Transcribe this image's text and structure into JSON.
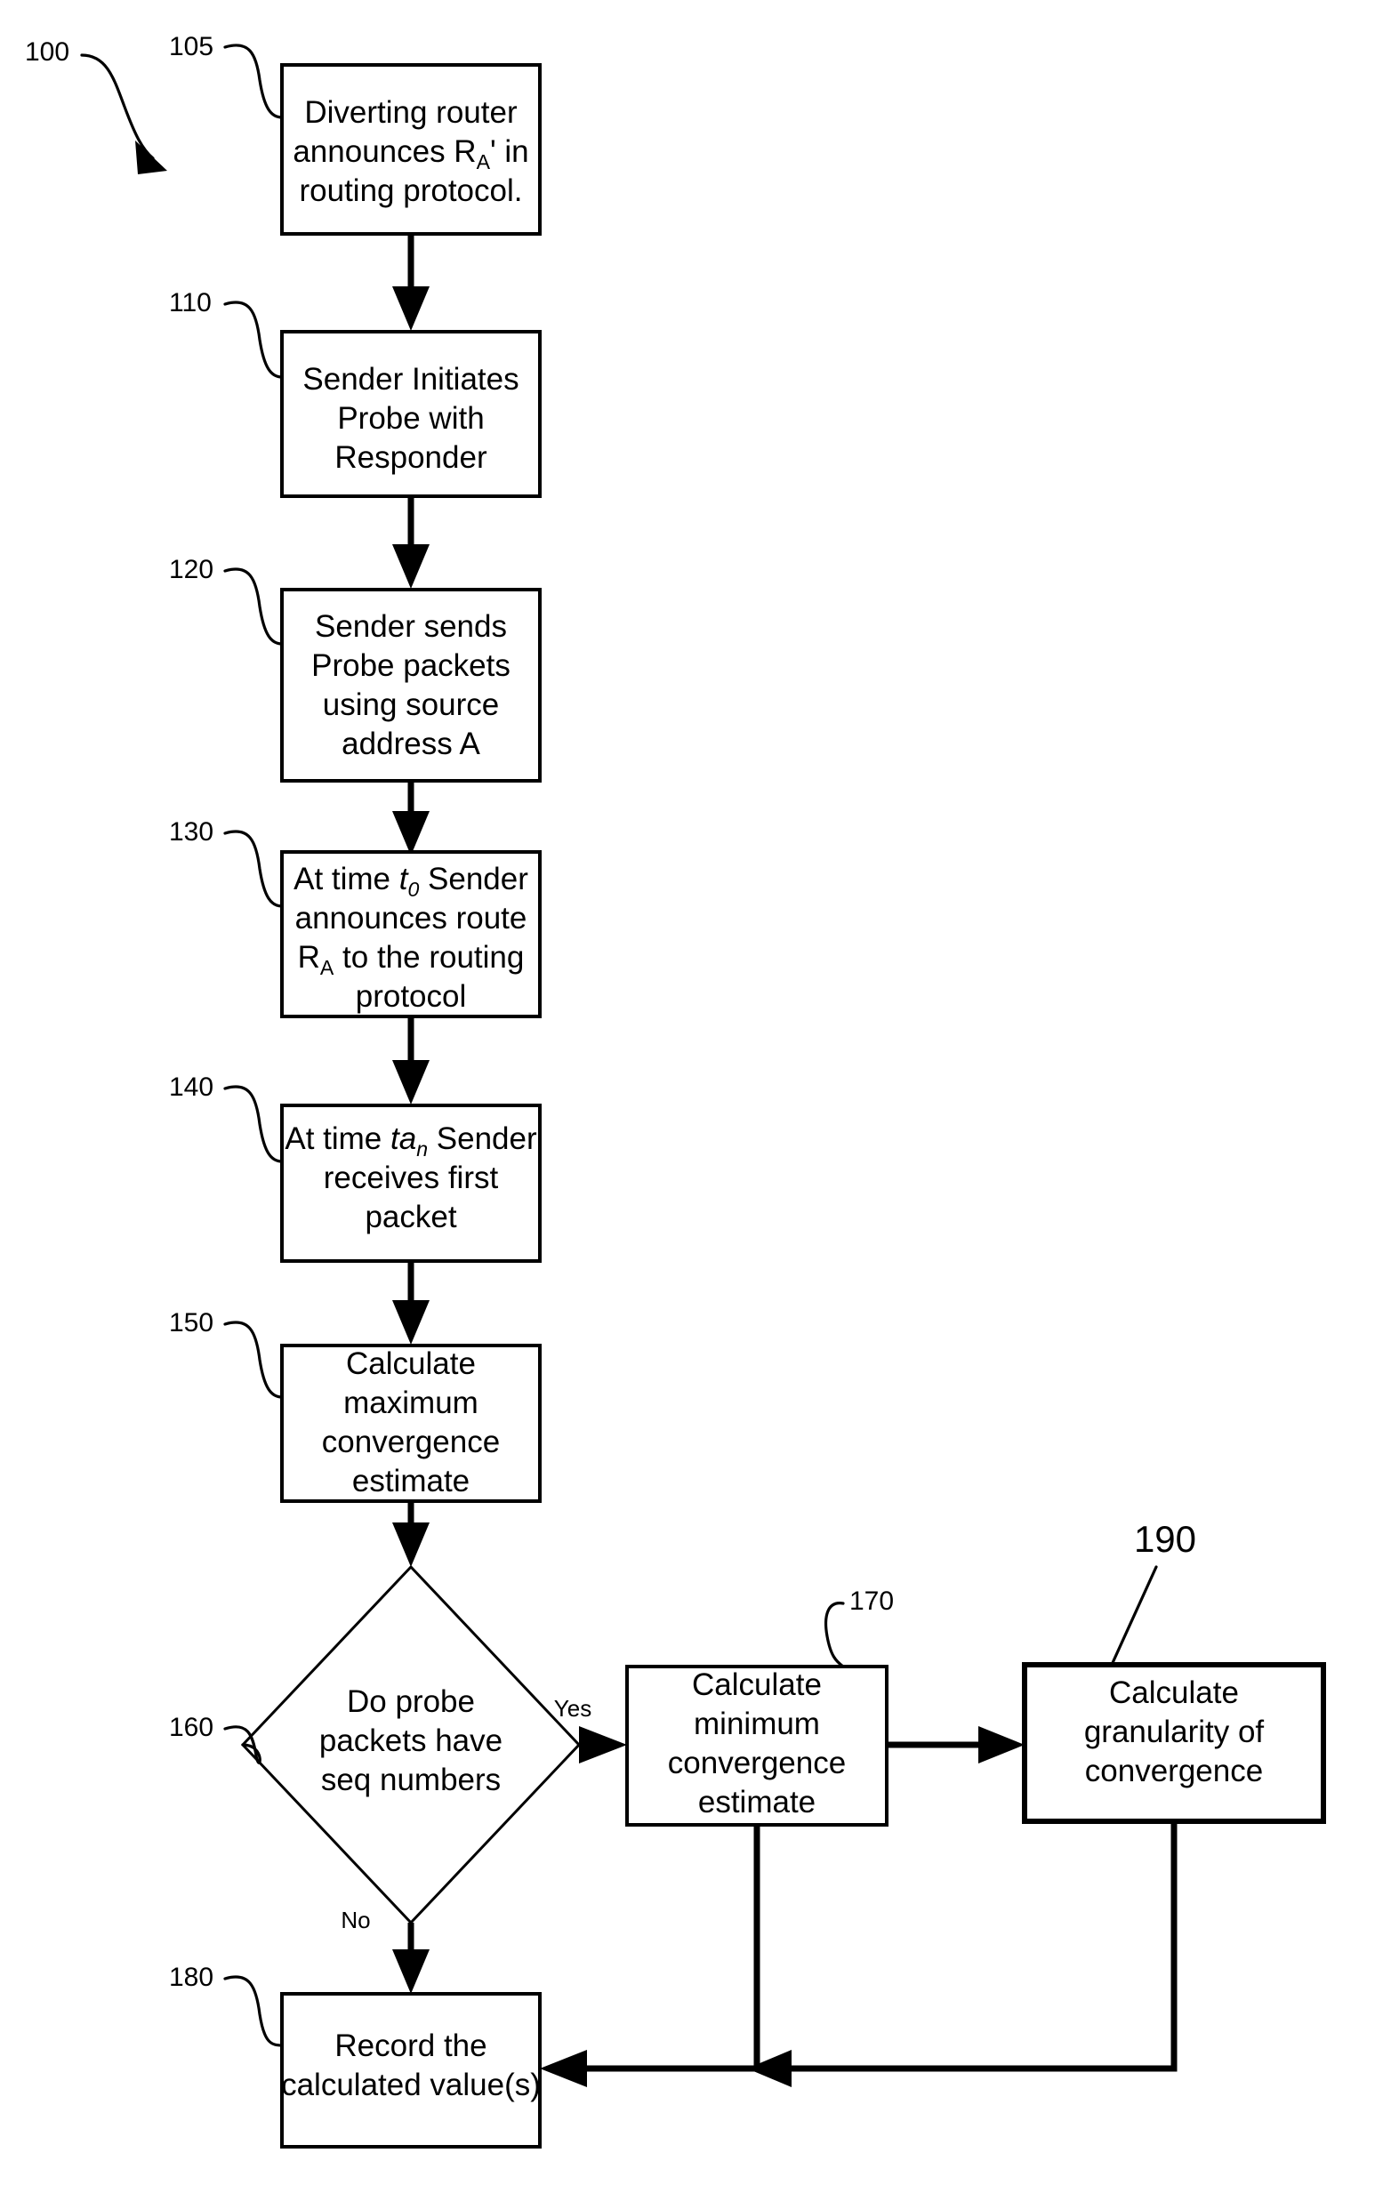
{
  "figure": {
    "figure_ref": "100",
    "nodes": [
      {
        "ref": "105",
        "kind": "process",
        "lines": [
          "Diverting router",
          "announces R_A' in",
          "routing protocol."
        ],
        "text": "Diverting router announces RA' in routing protocol."
      },
      {
        "ref": "110",
        "kind": "process",
        "lines": [
          "Sender Initiates",
          "Probe with",
          "Responder"
        ],
        "text": "Sender Initiates Probe with Responder"
      },
      {
        "ref": "120",
        "kind": "process",
        "lines": [
          "Sender sends",
          "Probe packets",
          "using source",
          "address A"
        ],
        "text": "Sender sends Probe packets using source address A"
      },
      {
        "ref": "130",
        "kind": "process",
        "lines": [
          "At time t_0 Sender",
          "announces route",
          "R_A to the routing",
          "protocol"
        ],
        "text": "At time t0 Sender announces route RA to the routing protocol"
      },
      {
        "ref": "140",
        "kind": "process",
        "lines": [
          "At time ta_n Sender",
          "receives first",
          "packet"
        ],
        "text": "At time tan Sender receives first packet"
      },
      {
        "ref": "150",
        "kind": "process",
        "lines": [
          "Calculate",
          "maximum",
          "convergence",
          "estimate"
        ],
        "text": "Calculate maximum convergence estimate"
      },
      {
        "ref": "160",
        "kind": "decision",
        "lines": [
          "Do probe",
          "packets have",
          "seq numbers"
        ],
        "text": "Do probe packets have seq numbers"
      },
      {
        "ref": "170",
        "kind": "process",
        "lines": [
          "Calculate",
          "minimum",
          "convergence",
          "estimate"
        ],
        "text": "Calculate minimum convergence estimate"
      },
      {
        "ref": "180",
        "kind": "process",
        "lines": [
          "Record the",
          "calculated value(s)"
        ],
        "text": "Record the calculated value(s)"
      },
      {
        "ref": "190",
        "kind": "process",
        "lines": [
          "Calculate",
          "granularity of",
          "convergence"
        ],
        "text": "Calculate granularity of convergence"
      }
    ],
    "edge_labels": {
      "yes": "Yes",
      "no": "No"
    },
    "node_text": {
      "n105_l1": "Diverting router",
      "n105_l2a": "announces R",
      "n105_l2b": "A",
      "n105_l2c": "' in",
      "n105_l3": "routing protocol.",
      "n110_l1": "Sender Initiates",
      "n110_l2": "Probe with",
      "n110_l3": "Responder",
      "n120_l1": "Sender sends",
      "n120_l2": "Probe packets",
      "n120_l3": "using source",
      "n120_l4": "address A",
      "n130_l1a": "At time ",
      "n130_l1b": "t",
      "n130_l1c": "0",
      "n130_l1d": " Sender",
      "n130_l2": "announces route",
      "n130_l3a": "R",
      "n130_l3b": "A",
      "n130_l3c": " to the routing",
      "n130_l4": "protocol",
      "n140_l1a": "At time ",
      "n140_l1b": "ta",
      "n140_l1c": "n",
      "n140_l1d": " Sender",
      "n140_l2": "receives first",
      "n140_l3": "packet",
      "n150_l1": "Calculate",
      "n150_l2": "maximum",
      "n150_l3": "convergence",
      "n150_l4": "estimate",
      "n160_l1": "Do probe",
      "n160_l2": "packets have",
      "n160_l3": "seq numbers",
      "n170_l1": "Calculate",
      "n170_l2": "minimum",
      "n170_l3": "convergence",
      "n170_l4": "estimate",
      "n180_l1": "Record the",
      "n180_l2": "calculated value(s)",
      "n190_l1": "Calculate",
      "n190_l2": "granularity of",
      "n190_l3": "convergence"
    },
    "refs": {
      "r100": "100",
      "r105": "105",
      "r110": "110",
      "r120": "120",
      "r130": "130",
      "r140": "140",
      "r150": "150",
      "r160": "160",
      "r170": "170",
      "r180": "180",
      "r190": "190"
    },
    "colors": {
      "stroke": "#000000",
      "fill": "#ffffff",
      "background": "#ffffff"
    }
  }
}
